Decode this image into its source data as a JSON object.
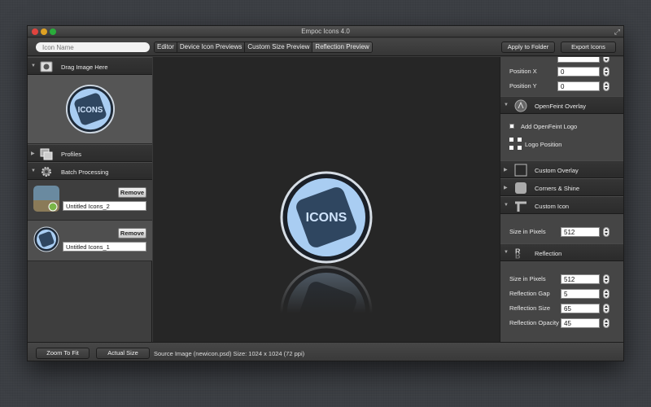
{
  "window": {
    "title": "Empoc Icons 4.0"
  },
  "toolbar": {
    "search_placeholder": "Icon Name",
    "tabs": [
      "Editor",
      "Device Icon Previews",
      "Custom Size Preview",
      "Reflection Preview"
    ],
    "apply_label": "Apply to Folder",
    "export_label": "Export Icons"
  },
  "left": {
    "drag_label": "Drag Image Here",
    "profiles_label": "Profiles",
    "batch_label": "Batch Processing",
    "batch_items": [
      {
        "remove_label": "Remove",
        "name": "Untitled Icons_2"
      },
      {
        "remove_label": "Remove",
        "name": "Untitled Icons_1"
      }
    ]
  },
  "canvas": {
    "icon_text": "ICONS"
  },
  "right": {
    "position_x_label": "Position X",
    "position_x_value": "0",
    "position_y_label": "Position Y",
    "position_y_value": "0",
    "openfeint_label": "OpenFeint Overlay",
    "add_logo_label": "Add OpenFeint Logo",
    "logo_position_label": "Logo Position",
    "custom_overlay_label": "Custom Overlay",
    "corners_label": "Corners & Shine",
    "custom_icon_label": "Custom Icon",
    "size_label": "Size in Pixels",
    "size_value": "512",
    "reflection_label": "Reflection",
    "ref_size_label": "Size in Pixels",
    "ref_size_value": "512",
    "ref_gap_label": "Reflection Gap",
    "ref_gap_value": "5",
    "ref_rsize_label": "Reflection Size",
    "ref_rsize_value": "65",
    "ref_opacity_label": "Reflection Opacity",
    "ref_opacity_value": "45"
  },
  "bottom": {
    "zoom_fit_label": "Zoom To Fit",
    "actual_size_label": "Actual Size",
    "status_text": "Source Image (newicon.psd) Size: 1024 x 1024 (72 ppi)"
  },
  "colors": {
    "icon_blue": "#a9cdf2",
    "icon_navy": "#2f4660",
    "canvas_bg": "#262626"
  }
}
